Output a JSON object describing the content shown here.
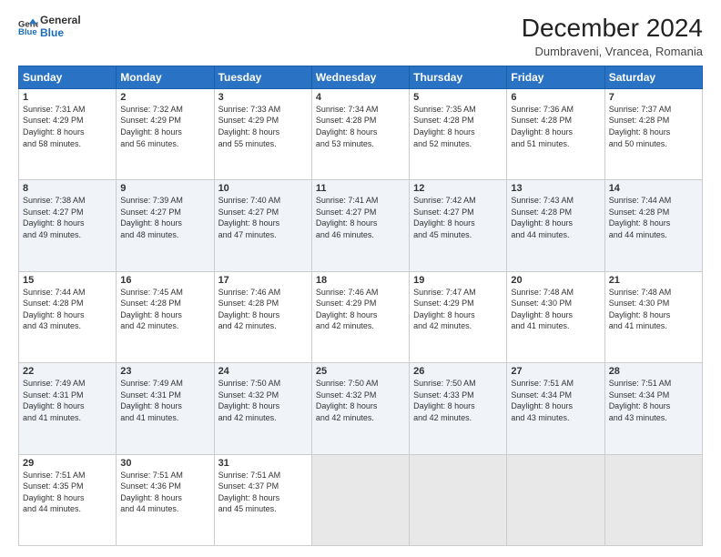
{
  "header": {
    "logo_line1": "General",
    "logo_line2": "Blue",
    "title": "December 2024",
    "subtitle": "Dumbraveni, Vrancea, Romania"
  },
  "columns": [
    "Sunday",
    "Monday",
    "Tuesday",
    "Wednesday",
    "Thursday",
    "Friday",
    "Saturday"
  ],
  "weeks": [
    [
      {
        "day": "1",
        "info": "Sunrise: 7:31 AM\nSunset: 4:29 PM\nDaylight: 8 hours\nand 58 minutes."
      },
      {
        "day": "2",
        "info": "Sunrise: 7:32 AM\nSunset: 4:29 PM\nDaylight: 8 hours\nand 56 minutes."
      },
      {
        "day": "3",
        "info": "Sunrise: 7:33 AM\nSunset: 4:29 PM\nDaylight: 8 hours\nand 55 minutes."
      },
      {
        "day": "4",
        "info": "Sunrise: 7:34 AM\nSunset: 4:28 PM\nDaylight: 8 hours\nand 53 minutes."
      },
      {
        "day": "5",
        "info": "Sunrise: 7:35 AM\nSunset: 4:28 PM\nDaylight: 8 hours\nand 52 minutes."
      },
      {
        "day": "6",
        "info": "Sunrise: 7:36 AM\nSunset: 4:28 PM\nDaylight: 8 hours\nand 51 minutes."
      },
      {
        "day": "7",
        "info": "Sunrise: 7:37 AM\nSunset: 4:28 PM\nDaylight: 8 hours\nand 50 minutes."
      }
    ],
    [
      {
        "day": "8",
        "info": "Sunrise: 7:38 AM\nSunset: 4:27 PM\nDaylight: 8 hours\nand 49 minutes."
      },
      {
        "day": "9",
        "info": "Sunrise: 7:39 AM\nSunset: 4:27 PM\nDaylight: 8 hours\nand 48 minutes."
      },
      {
        "day": "10",
        "info": "Sunrise: 7:40 AM\nSunset: 4:27 PM\nDaylight: 8 hours\nand 47 minutes."
      },
      {
        "day": "11",
        "info": "Sunrise: 7:41 AM\nSunset: 4:27 PM\nDaylight: 8 hours\nand 46 minutes."
      },
      {
        "day": "12",
        "info": "Sunrise: 7:42 AM\nSunset: 4:27 PM\nDaylight: 8 hours\nand 45 minutes."
      },
      {
        "day": "13",
        "info": "Sunrise: 7:43 AM\nSunset: 4:28 PM\nDaylight: 8 hours\nand 44 minutes."
      },
      {
        "day": "14",
        "info": "Sunrise: 7:44 AM\nSunset: 4:28 PM\nDaylight: 8 hours\nand 44 minutes."
      }
    ],
    [
      {
        "day": "15",
        "info": "Sunrise: 7:44 AM\nSunset: 4:28 PM\nDaylight: 8 hours\nand 43 minutes."
      },
      {
        "day": "16",
        "info": "Sunrise: 7:45 AM\nSunset: 4:28 PM\nDaylight: 8 hours\nand 42 minutes."
      },
      {
        "day": "17",
        "info": "Sunrise: 7:46 AM\nSunset: 4:28 PM\nDaylight: 8 hours\nand 42 minutes."
      },
      {
        "day": "18",
        "info": "Sunrise: 7:46 AM\nSunset: 4:29 PM\nDaylight: 8 hours\nand 42 minutes."
      },
      {
        "day": "19",
        "info": "Sunrise: 7:47 AM\nSunset: 4:29 PM\nDaylight: 8 hours\nand 42 minutes."
      },
      {
        "day": "20",
        "info": "Sunrise: 7:48 AM\nSunset: 4:30 PM\nDaylight: 8 hours\nand 41 minutes."
      },
      {
        "day": "21",
        "info": "Sunrise: 7:48 AM\nSunset: 4:30 PM\nDaylight: 8 hours\nand 41 minutes."
      }
    ],
    [
      {
        "day": "22",
        "info": "Sunrise: 7:49 AM\nSunset: 4:31 PM\nDaylight: 8 hours\nand 41 minutes."
      },
      {
        "day": "23",
        "info": "Sunrise: 7:49 AM\nSunset: 4:31 PM\nDaylight: 8 hours\nand 41 minutes."
      },
      {
        "day": "24",
        "info": "Sunrise: 7:50 AM\nSunset: 4:32 PM\nDaylight: 8 hours\nand 42 minutes."
      },
      {
        "day": "25",
        "info": "Sunrise: 7:50 AM\nSunset: 4:32 PM\nDaylight: 8 hours\nand 42 minutes."
      },
      {
        "day": "26",
        "info": "Sunrise: 7:50 AM\nSunset: 4:33 PM\nDaylight: 8 hours\nand 42 minutes."
      },
      {
        "day": "27",
        "info": "Sunrise: 7:51 AM\nSunset: 4:34 PM\nDaylight: 8 hours\nand 43 minutes."
      },
      {
        "day": "28",
        "info": "Sunrise: 7:51 AM\nSunset: 4:34 PM\nDaylight: 8 hours\nand 43 minutes."
      }
    ],
    [
      {
        "day": "29",
        "info": "Sunrise: 7:51 AM\nSunset: 4:35 PM\nDaylight: 8 hours\nand 44 minutes."
      },
      {
        "day": "30",
        "info": "Sunrise: 7:51 AM\nSunset: 4:36 PM\nDaylight: 8 hours\nand 44 minutes."
      },
      {
        "day": "31",
        "info": "Sunrise: 7:51 AM\nSunset: 4:37 PM\nDaylight: 8 hours\nand 45 minutes."
      },
      null,
      null,
      null,
      null
    ]
  ]
}
